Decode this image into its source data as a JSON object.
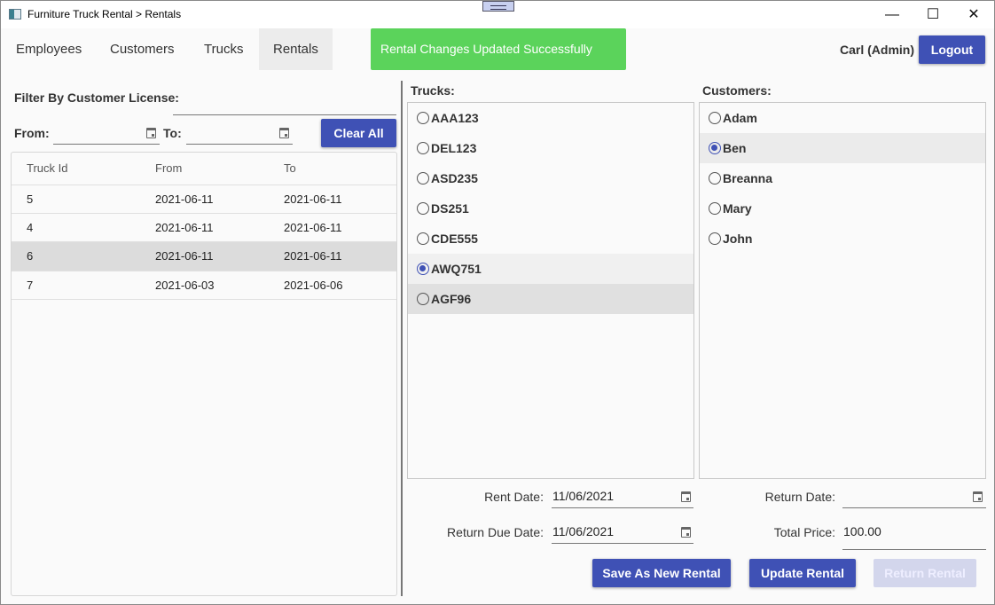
{
  "window": {
    "title": "Furniture Truck Rental > Rentals",
    "controls": [
      "minimize",
      "maximize",
      "close"
    ]
  },
  "nav": {
    "tabs": [
      {
        "label": "Employees"
      },
      {
        "label": "Customers"
      },
      {
        "label": "Trucks"
      },
      {
        "label": "Rentals",
        "active": true
      }
    ]
  },
  "toast": {
    "message": "Rental Changes Updated Successfully",
    "color": "#5bd35b"
  },
  "user": {
    "name": "Carl (Admin)",
    "logout_label": "Logout"
  },
  "filter": {
    "license_label": "Filter By Customer License:",
    "license_value": "",
    "from_label": "From:",
    "from_value": "",
    "to_label": "To:",
    "to_value": "",
    "clear_label": "Clear All"
  },
  "table": {
    "columns": [
      "Truck Id",
      "From",
      "To"
    ],
    "rows": [
      {
        "truck_id": "5",
        "from": "2021-06-11",
        "to": "2021-06-11"
      },
      {
        "truck_id": "4",
        "from": "2021-06-11",
        "to": "2021-06-11"
      },
      {
        "truck_id": "6",
        "from": "2021-06-11",
        "to": "2021-06-11",
        "selected": true
      },
      {
        "truck_id": "7",
        "from": "2021-06-03",
        "to": "2021-06-06"
      }
    ]
  },
  "trucks": {
    "label": "Trucks:",
    "items": [
      "AAA123",
      "DEL123",
      "ASD235",
      "DS251",
      "CDE555",
      "AWQ751",
      "AGF96"
    ],
    "selected": "AWQ751"
  },
  "customers": {
    "label": "Customers:",
    "items": [
      "Adam",
      "Ben",
      "Breanna",
      "Mary",
      "John"
    ],
    "selected": "Ben"
  },
  "form": {
    "rent_date_label": "Rent Date:",
    "rent_date": "11/06/2021",
    "due_date_label": "Return Due Date:",
    "due_date": "11/06/2021",
    "return_date_label": "Return Date:",
    "return_date": "",
    "price_label": "Total Price:",
    "price": "100.00"
  },
  "actions": {
    "save_new": "Save As New Rental",
    "update": "Update Rental",
    "return": "Return Rental"
  },
  "colors": {
    "primary": "#3f51b5",
    "success": "#5bd35b"
  }
}
